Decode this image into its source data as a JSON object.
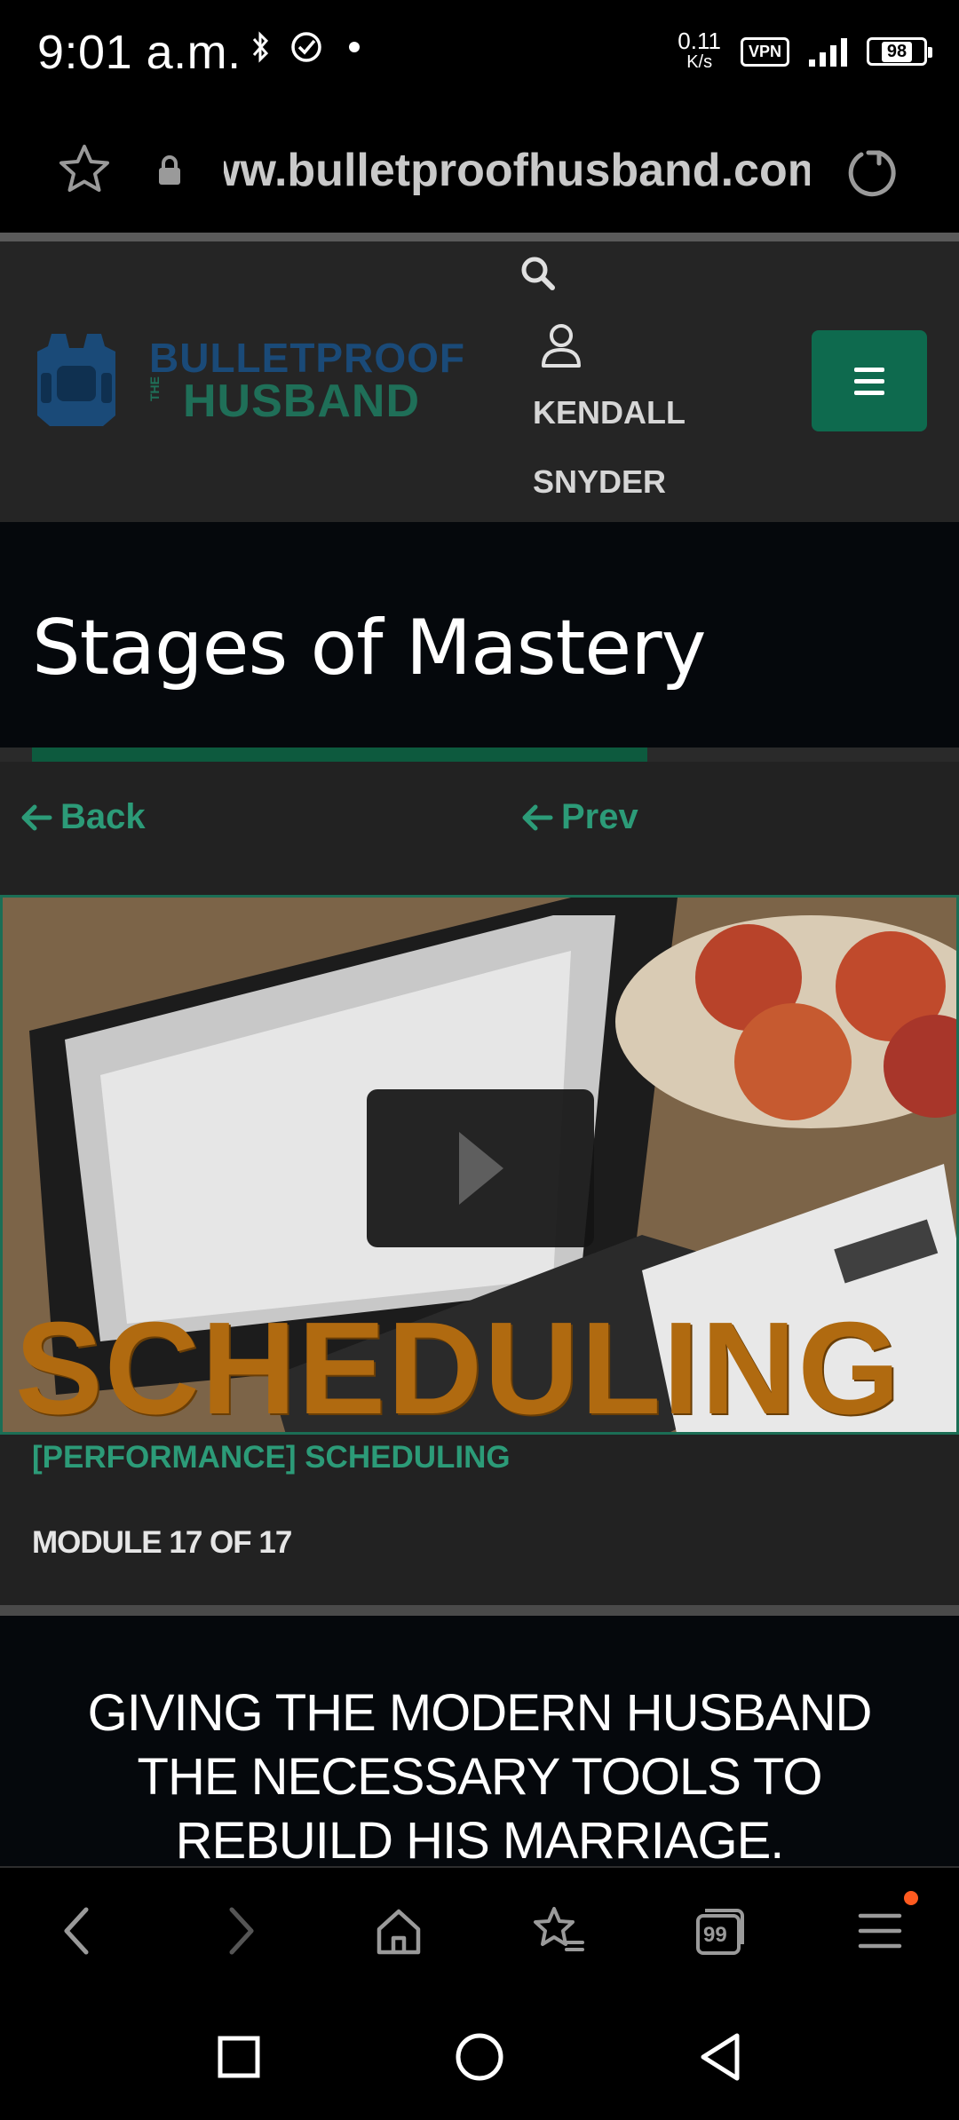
{
  "status_bar": {
    "time": "9:01 a.m.",
    "net_speed_value": "0.11",
    "net_speed_unit": "K/s",
    "vpn_label": "VPN",
    "battery_level": "98"
  },
  "browser": {
    "url_display": "ww.bulletproofhusband.com"
  },
  "site_header": {
    "logo_line1": "BULLETPROOF",
    "logo_the": "THE",
    "logo_line2": "HUSBAND",
    "user_first_name": "KENDALL",
    "user_last_name": "SNYDER"
  },
  "page": {
    "title": "Stages of Mastery",
    "progress_fraction": 0.675
  },
  "nav": {
    "back_label": "Back",
    "prev_label": "Prev"
  },
  "video": {
    "overlay_text": "SCHEDULING"
  },
  "module": {
    "lesson_name": "[PERFORMANCE] SCHEDULING",
    "module_count": "MODULE 17 OF 17"
  },
  "tagline": {
    "text": "GIVING THE MODERN HUSBAND THE NECESSARY TOOLS TO REBUILD HIS MARRIAGE."
  },
  "browser_toolbar": {
    "tabs_count": "99"
  },
  "colors": {
    "accent_green": "#2c9b78",
    "menu_button_bg": "#0e6a4e",
    "notification_dot": "#ff5a1f"
  }
}
